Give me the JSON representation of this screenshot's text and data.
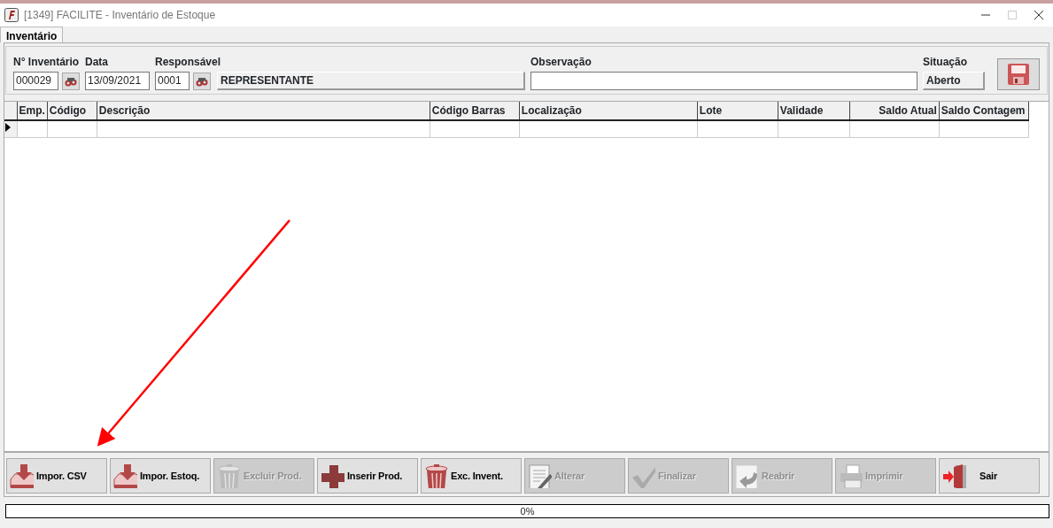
{
  "window": {
    "title": "[1349] FACILITE - Inventário de Estoque"
  },
  "tabs": [
    {
      "label": "Inventário",
      "selected": true
    }
  ],
  "fields": [
    {
      "label": "N° Inventário",
      "value": "000029",
      "kind": "lookup"
    },
    {
      "label": "Data",
      "value": "13/09/2021",
      "kind": "text"
    },
    {
      "label": "Responsável",
      "value": "0001",
      "kind": "lookup",
      "detail": "REPRESENTANTE"
    },
    {
      "label": "Observação",
      "kind": "wide"
    },
    {
      "label": "Situação",
      "value": "Aberto",
      "kind": "readonly"
    }
  ],
  "grid": {
    "columns": [
      {
        "label": "Emp."
      },
      {
        "label": "Código"
      },
      {
        "label": "Descrição"
      },
      {
        "label": "Código Barras"
      },
      {
        "label": "Localização"
      },
      {
        "label": "Lote"
      },
      {
        "label": "Validade"
      },
      {
        "label": "Saldo Atual"
      },
      {
        "label": "Saldo Contagem"
      }
    ]
  },
  "buttons": [
    {
      "label": "Impor. CSV",
      "kind": "import",
      "disabled": false
    },
    {
      "label": "Impor. Estoq.",
      "kind": "import",
      "disabled": false
    },
    {
      "label": "Excluir Prod.",
      "kind": "trash",
      "disabled": true
    },
    {
      "label": "Inserir Prod.",
      "kind": "plus",
      "disabled": false
    },
    {
      "label": "Exc. Invent.",
      "kind": "trash",
      "disabled": false
    },
    {
      "label": "Alterar",
      "kind": "edit",
      "disabled": true
    },
    {
      "label": "Finalizar",
      "kind": "check",
      "disabled": true
    },
    {
      "label": "Reabrir",
      "kind": "undo",
      "disabled": true
    },
    {
      "label": "Imprimir",
      "kind": "print",
      "disabled": true
    },
    {
      "label": "Sair",
      "kind": "exit",
      "disabled": false
    }
  ],
  "progress": {
    "level": 0,
    "reading": "0%"
  }
}
